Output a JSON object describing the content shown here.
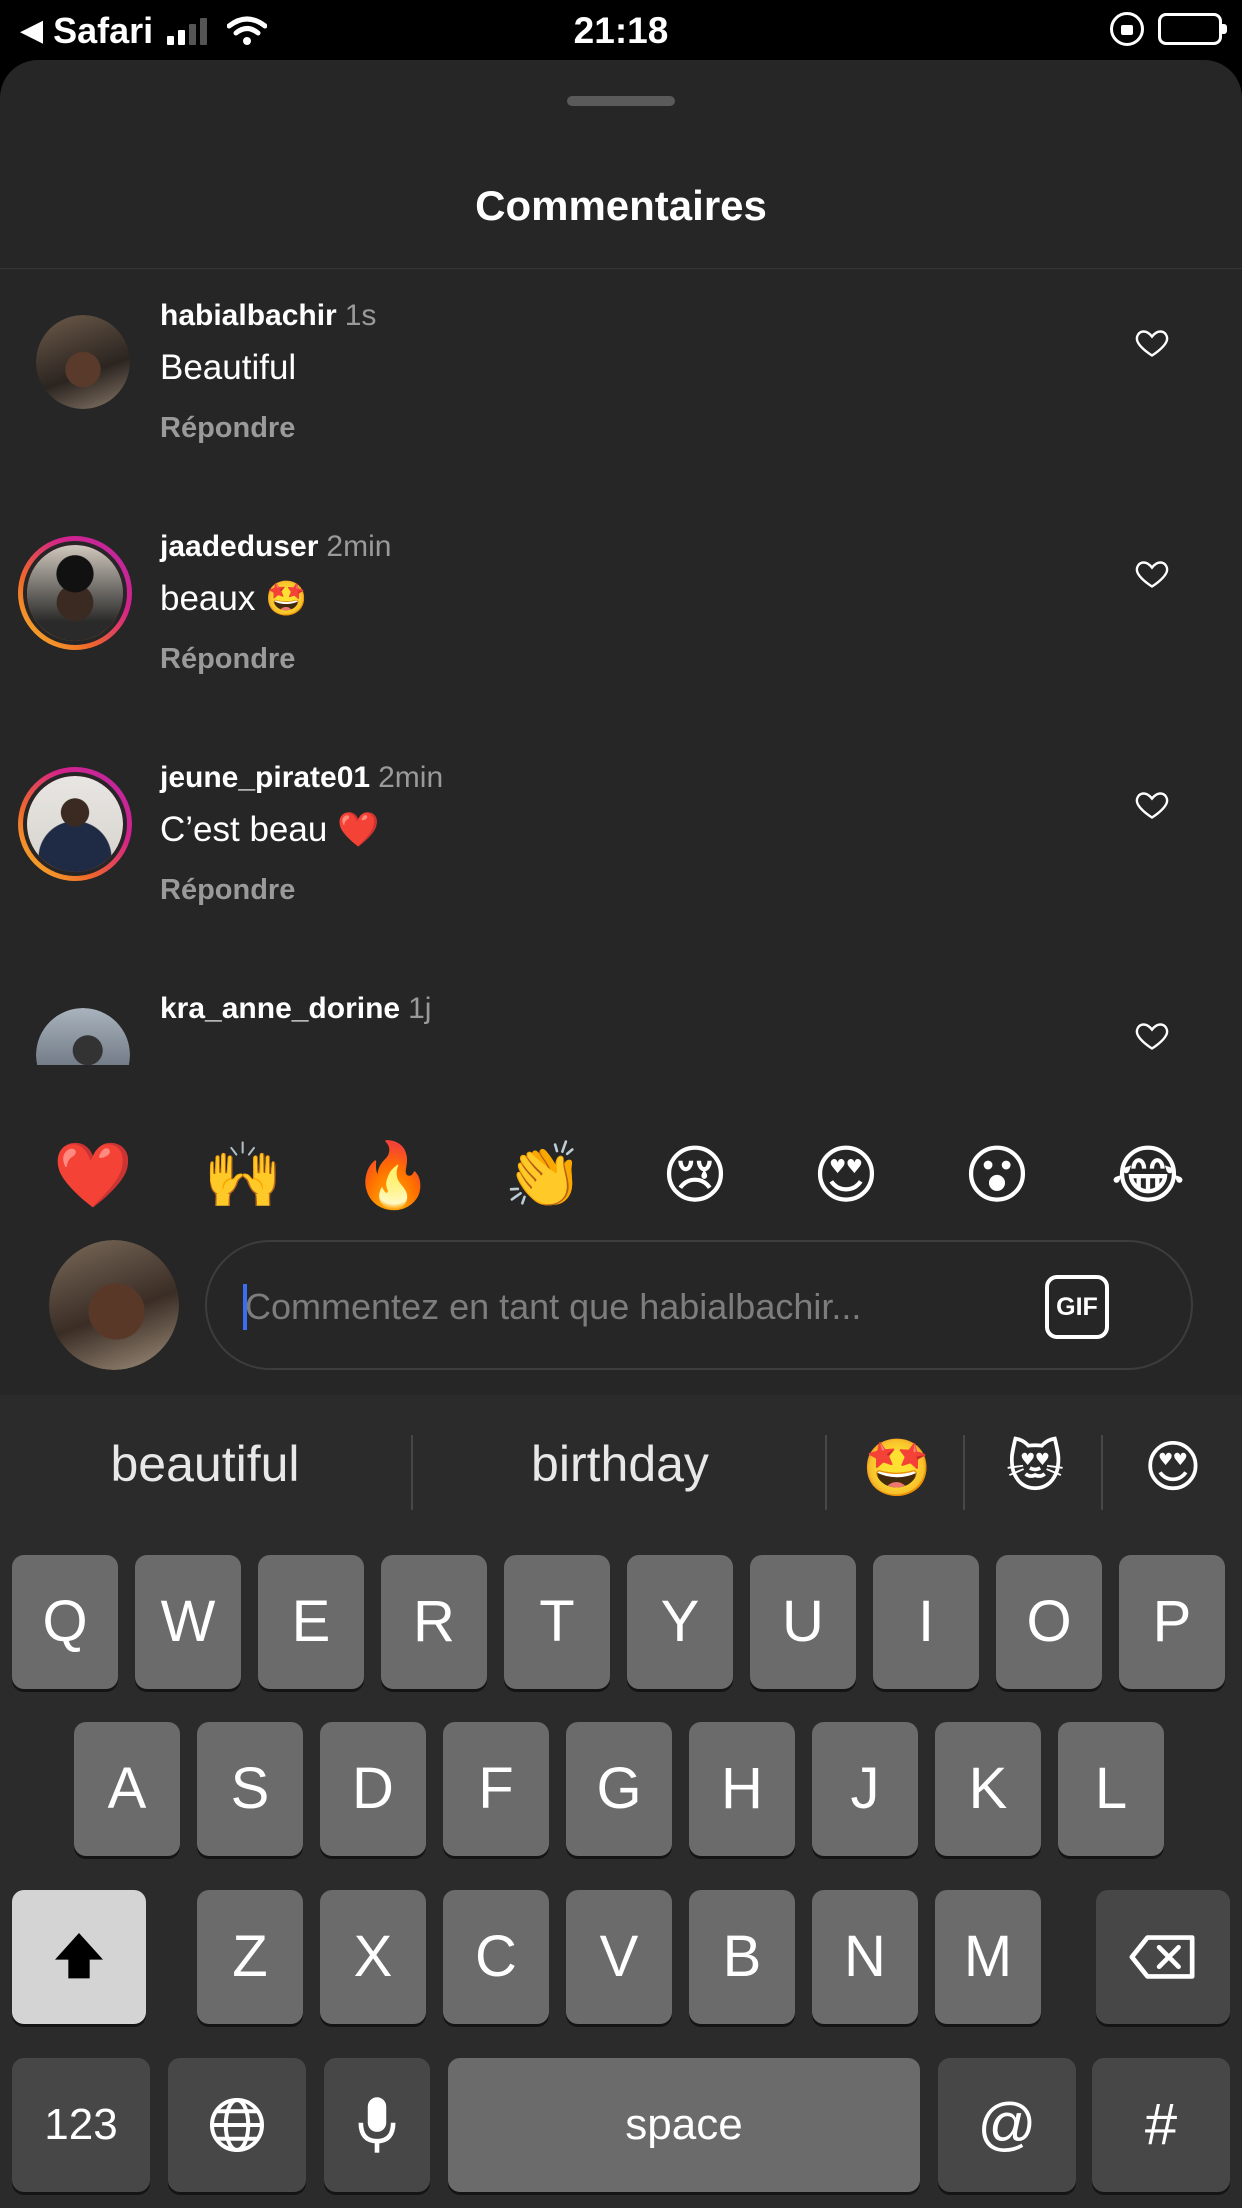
{
  "status_bar": {
    "back_app": "Safari",
    "time": "21:18"
  },
  "sheet": {
    "title": "Commentaires"
  },
  "comments": [
    {
      "user": "habialbachir",
      "time": "1s",
      "text": "Beautiful",
      "emoji": "",
      "reply": "Répondre"
    },
    {
      "user": "jaadeduser",
      "time": "2min",
      "text": "beaux",
      "emoji": "🤩",
      "reply": "Répondre"
    },
    {
      "user": "jeune_pirate01",
      "time": "2min",
      "text": "C’est beau",
      "emoji": "❤️",
      "reply": "Répondre"
    },
    {
      "user": "kra_anne_dorine",
      "time": "1j",
      "text": ""
    }
  ],
  "quick_reactions": [
    "❤️",
    "🙌",
    "🔥",
    "👏",
    "😢",
    "😍",
    "😮",
    "😂"
  ],
  "composer": {
    "placeholder": "Commentez en tant que habialbachir...",
    "gif_label": "GIF"
  },
  "keyboard": {
    "suggestions": [
      "beautiful",
      "birthday"
    ],
    "suggestion_emojis": [
      "🤩",
      "😻",
      "😍"
    ],
    "row1": [
      "Q",
      "W",
      "E",
      "R",
      "T",
      "Y",
      "U",
      "I",
      "O",
      "P"
    ],
    "row2": [
      "A",
      "S",
      "D",
      "F",
      "G",
      "H",
      "J",
      "K",
      "L"
    ],
    "row3": [
      "Z",
      "X",
      "C",
      "V",
      "B",
      "N",
      "M"
    ],
    "numbers_key": "123",
    "space_key": "space",
    "at_key": "@",
    "hash_key": "#"
  }
}
